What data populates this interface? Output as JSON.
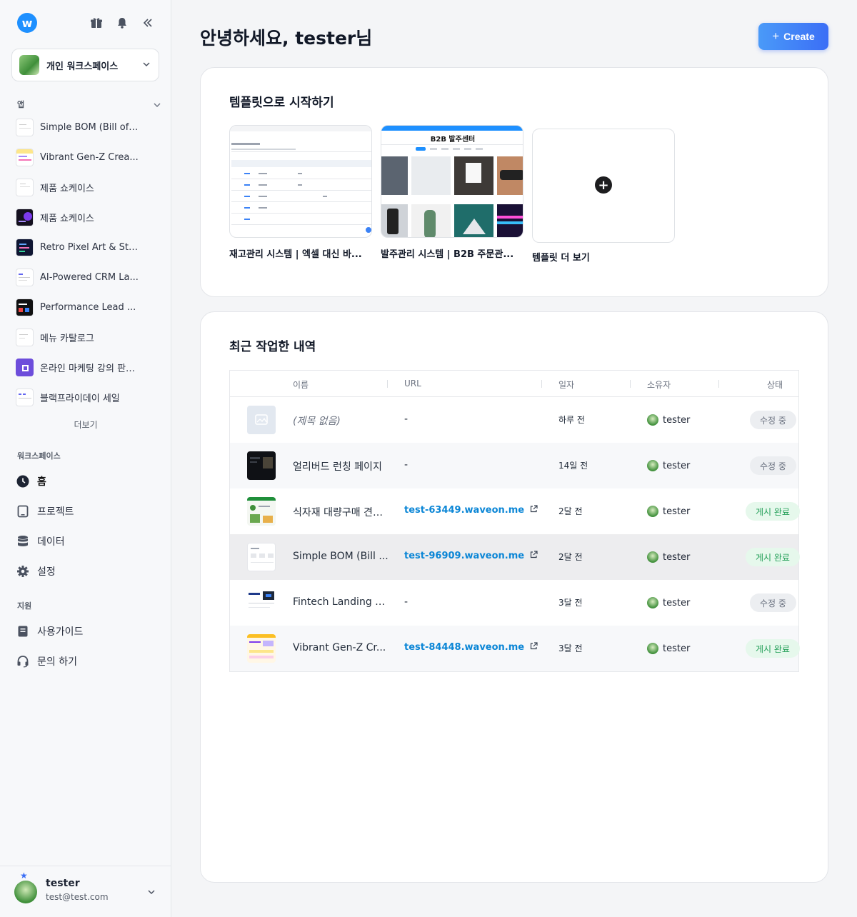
{
  "sidebar": {
    "logo": "w",
    "workspace_name": "개인 워크스페이스",
    "apps_label": "앱",
    "apps": [
      {
        "label": "Simple BOM (Bill of ..."
      },
      {
        "label": "Vibrant Gen-Z Crea..."
      },
      {
        "label": "제품 쇼케이스"
      },
      {
        "label": "제품 쇼케이스"
      },
      {
        "label": "Retro Pixel Art & Str..."
      },
      {
        "label": "AI-Powered CRM La..."
      },
      {
        "label": "Performance Lead ..."
      },
      {
        "label": "메뉴 카탈로그"
      },
      {
        "label": "온라인 마케팅 강의 판매..."
      },
      {
        "label": "블랙프라이데이 세일"
      }
    ],
    "more_label": "더보기",
    "workspace_label": "워크스페이스",
    "nav": [
      {
        "label": "홈",
        "icon": "clock-icon"
      },
      {
        "label": "프로젝트",
        "icon": "tablet-icon"
      },
      {
        "label": "데이터",
        "icon": "database-icon"
      },
      {
        "label": "설정",
        "icon": "gear-icon"
      }
    ],
    "support_label": "지원",
    "support": [
      {
        "label": "사용가이드",
        "icon": "book-icon"
      },
      {
        "label": "문의 하기",
        "icon": "headset-icon"
      }
    ],
    "user": {
      "name": "tester",
      "email": "test@test.com"
    }
  },
  "header": {
    "greeting": "안녕하세요, tester님",
    "create_label": "Create"
  },
  "templates": {
    "title": "템플릿으로 시작하기",
    "items": [
      {
        "label": "재고관리 시스템 | 엑셀 대신 바..."
      },
      {
        "label": "발주관리 시스템 | B2B 주문관...",
        "preview_title": "B2B 발주센터"
      }
    ],
    "more_label": "템플릿 더 보기"
  },
  "recent": {
    "title": "최근 작업한 내역",
    "columns": [
      "이름",
      "URL",
      "일자",
      "소유자",
      "상태"
    ],
    "rows": [
      {
        "name": "(제목 없음)",
        "url": "-",
        "date": "하루 전",
        "owner": "tester",
        "status": "수정 중"
      },
      {
        "name": "얼리버드 런칭 페이지",
        "url": "-",
        "date": "14일 전",
        "owner": "tester",
        "status": "수정 중"
      },
      {
        "name": "식자재 대량구매 견적...",
        "url": "test-63449.waveon.me",
        "date": "2달 전",
        "owner": "tester",
        "status": "게시 완료"
      },
      {
        "name": "Simple BOM (Bill ...",
        "url": "test-96909.waveon.me",
        "date": "2달 전",
        "owner": "tester",
        "status": "게시 완료"
      },
      {
        "name": "Fintech Landing P...",
        "url": "-",
        "date": "3달 전",
        "owner": "tester",
        "status": "수정 중"
      },
      {
        "name": "Vibrant Gen-Z Cr...",
        "url": "test-84448.waveon.me",
        "date": "3달 전",
        "owner": "tester",
        "status": "게시 완료"
      }
    ]
  },
  "colors": {
    "accent": "#3b6ef6",
    "link": "#0b86d6",
    "published_bg": "#e6f8ec",
    "published_text": "#1f9d55"
  }
}
